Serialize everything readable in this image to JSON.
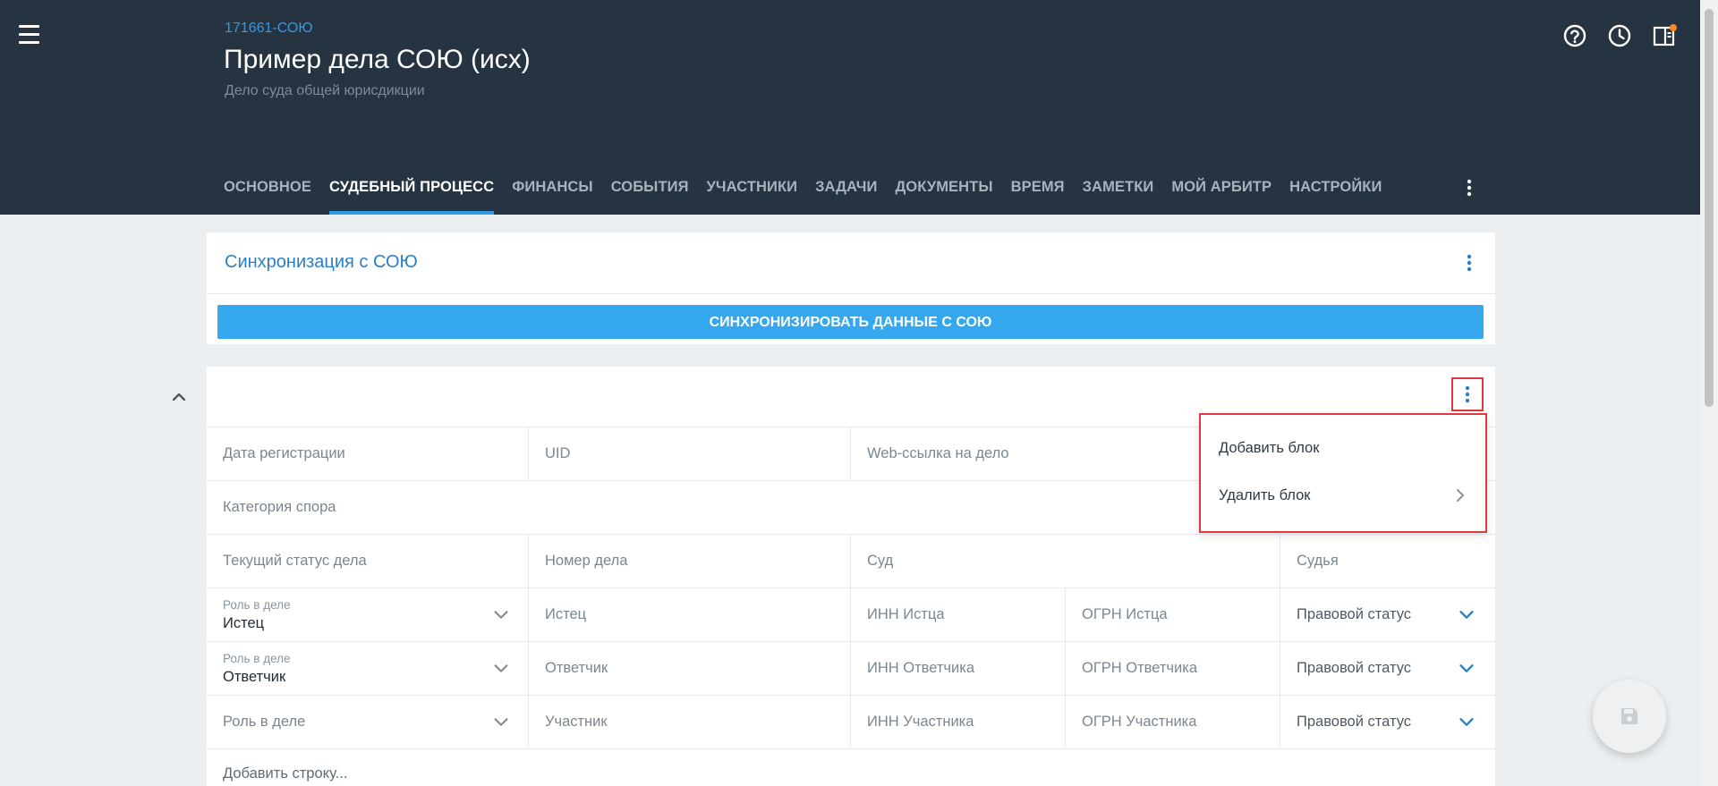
{
  "header": {
    "case_number": "171661-СОЮ",
    "title": "Пример дела СОЮ (исх)",
    "subtitle": "Дело суда общей юрисдикции",
    "icons": [
      "menu-icon",
      "help-icon",
      "history-icon",
      "panel-icon"
    ]
  },
  "tabs": [
    {
      "label": "Основное"
    },
    {
      "label": "Судебный процесс"
    },
    {
      "label": "Финансы"
    },
    {
      "label": "События"
    },
    {
      "label": "Участники"
    },
    {
      "label": "Задачи"
    },
    {
      "label": "Документы"
    },
    {
      "label": "Время"
    },
    {
      "label": "Заметки"
    },
    {
      "label": "Мой Арбитр"
    },
    {
      "label": "Настройки"
    }
  ],
  "active_tab": "Судебный процесс",
  "sync": {
    "title": "Синхронизация с СОЮ",
    "button": "Синхронизировать данные с СОЮ"
  },
  "block": {
    "fields": {
      "reg_date": "Дата регистрации",
      "uid": "UID",
      "web_link": "Web-ссылка на дело",
      "category": "Категория спора",
      "status": "Текущий статус дела",
      "case_no": "Номер дела",
      "court": "Суд",
      "judge": "Судья"
    },
    "participants": [
      {
        "role_label": "Роль в деле",
        "role_value": "Истец",
        "name": "Истец",
        "inn": "ИНН Истца",
        "ogrn": "ОГРН Истца",
        "legal_status": "Правовой статус"
      },
      {
        "role_label": "Роль в деле",
        "role_value": "Ответчик",
        "name": "Ответчик",
        "inn": "ИНН Ответчика",
        "ogrn": "ОГРН Ответчика",
        "legal_status": "Правовой статус"
      },
      {
        "role_label": "Роль в деле",
        "role_value": "",
        "name": "Участник",
        "inn": "ИНН Участника",
        "ogrn": "ОГРН Участника",
        "legal_status": "Правовой статус"
      }
    ],
    "add_row": "Добавить строку..."
  },
  "menu": {
    "items": [
      {
        "label": "Добавить блок"
      },
      {
        "label": "Удалить блок"
      }
    ]
  },
  "colors": {
    "header_bg": "#263341",
    "accent": "#2f9be6",
    "sync_button": "#35a7ee",
    "highlight": "#e0383f"
  }
}
